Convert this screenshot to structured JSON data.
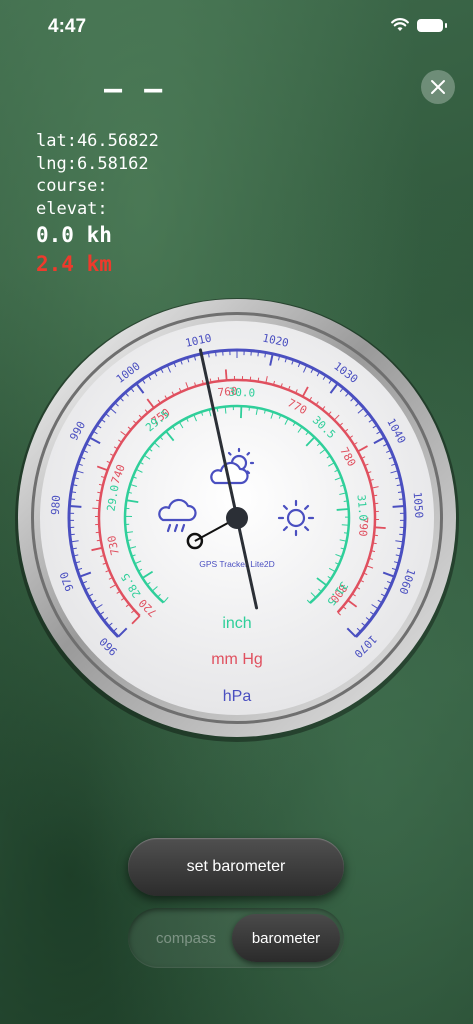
{
  "status_bar": {
    "time": "4:47"
  },
  "heading": {
    "dash": "— —"
  },
  "info": {
    "lat": "lat:46.56822",
    "lng": "lng:6.58162",
    "course": "course:",
    "elevat": "elevat:",
    "speed": "0.0 kh",
    "distance": "2.4 km"
  },
  "barometer": {
    "brand": "GPS Tracker Lite2D",
    "unit_inch": "inch",
    "unit_mmhg": "mm Hg",
    "unit_hpa": "hPa",
    "hpa_labels": [
      "960",
      "970",
      "980",
      "990",
      "1000",
      "1010",
      "1020",
      "1030",
      "1040",
      "1050",
      "1060",
      "1070"
    ],
    "mmhg_labels": [
      "720",
      "730",
      "740",
      "750",
      "760",
      "770",
      "780",
      "790",
      "800"
    ],
    "inch_labels": [
      "28.5",
      "29.0",
      "29.5",
      "30.0",
      "30.5",
      "31.0",
      "31.5"
    ],
    "pointer_hpa": 1010,
    "reference_hpa": 1040,
    "colors": {
      "hpa": "#4a4fc0",
      "mmhg": "#e0505f",
      "inch": "#2fcf9a"
    },
    "icons": [
      "cloud-sun-icon",
      "rain-cloud-icon",
      "sun-icon"
    ]
  },
  "buttons": {
    "set_barometer": "set barometer",
    "compass": "compass",
    "barometer": "barometer"
  }
}
